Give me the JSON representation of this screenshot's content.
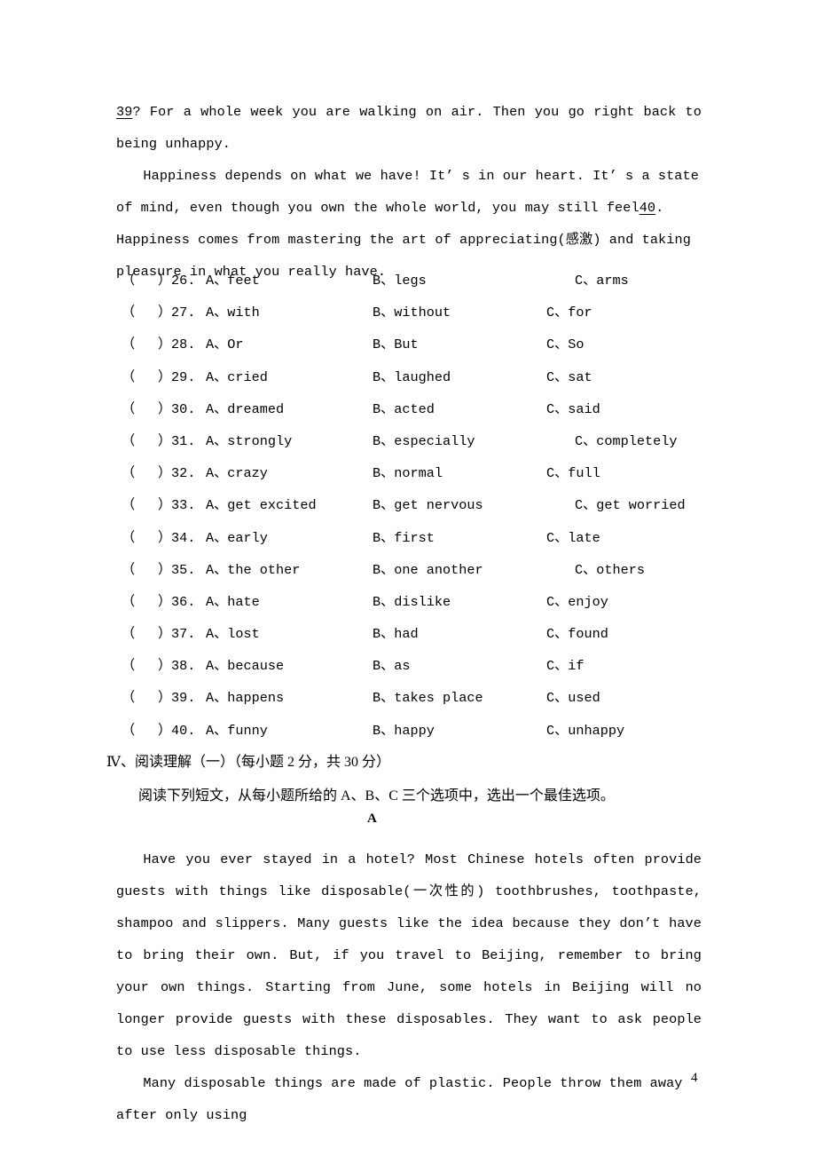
{
  "document": {
    "page_number": "4"
  },
  "cloze_passage": {
    "paragraphs": [
      {
        "blank_prefix": "39",
        "text": "? For a whole week you are walking on air. Then you go right back to being unhappy.",
        "indent": false
      },
      {
        "text_before_blank": "Happiness depends on what we have! It’ s in our heart. It’ s a state of mind, even though you own the whole world, you may still feel",
        "blank_inline": "40",
        "text_after_blank": ". Happiness comes from mastering the art of appreciating(感激) and taking pleasure in what you really have.",
        "indent": true
      }
    ]
  },
  "options": {
    "column_headers": [
      "A",
      "B",
      "C"
    ],
    "paren_open": "（",
    "paren_close": "）",
    "separator": "、",
    "rows": [
      {
        "number": "26.",
        "a": "A、feet",
        "b": "B、legs",
        "c": "C、arms",
        "c_shifted": true
      },
      {
        "number": "27.",
        "a": "A、with",
        "b": "B、without",
        "c": "C、for",
        "c_shifted": false
      },
      {
        "number": "28.",
        "a": "A、Or",
        "b": "B、But",
        "c": "C、So",
        "c_shifted": false
      },
      {
        "number": "29.",
        "a": "A、cried",
        "b": "B、laughed",
        "c": "C、sat",
        "c_shifted": false
      },
      {
        "number": "30.",
        "a": "A、dreamed",
        "b": "B、acted",
        "c": "C、said",
        "c_shifted": false
      },
      {
        "number": "31.",
        "a": "A、strongly",
        "b": "B、especially",
        "c": "C、completely",
        "c_shifted": true
      },
      {
        "number": "32.",
        "a": "A、crazy",
        "b": "B、normal",
        "c": "C、full",
        "c_shifted": false
      },
      {
        "number": "33.",
        "a": "A、get excited",
        "b": "B、get nervous",
        "c": "C、get worried",
        "c_shifted": true
      },
      {
        "number": "34.",
        "a": "A、early",
        "b": "B、first",
        "c": "C、late",
        "c_shifted": false
      },
      {
        "number": "35.",
        "a": "A、the other",
        "b": "B、one another",
        "c": "C、others",
        "c_shifted": true
      },
      {
        "number": "36.",
        "a": "A、hate",
        "b": "B、dislike",
        "c": "C、enjoy",
        "c_shifted": false
      },
      {
        "number": "37.",
        "a": "A、lost",
        "b": "B、had",
        "c": "C、found",
        "c_shifted": false
      },
      {
        "number": "38.",
        "a": "A、because",
        "b": "B、as",
        "c": "C、if",
        "c_shifted": false
      },
      {
        "number": "39.",
        "a": "A、happens",
        "b": "B、takes place",
        "c": "C、used",
        "c_shifted": false
      },
      {
        "number": "40.",
        "a": "A、funny",
        "b": "B、happy",
        "c": "C、unhappy",
        "c_shifted": false
      }
    ]
  },
  "reading_section": {
    "heading": "Ⅳ、阅读理解（一）（每小题 2 分，共 30 分）",
    "instruction": "阅读下列短文，从每小题所给的 A、B、C 三个选项中，选出一个最佳选项。",
    "passage_label": "A",
    "paragraphs": [
      "Have you ever stayed in a hotel? Most Chinese hotels often provide guests with things like disposable(一次性的) toothbrushes, toothpaste, shampoo and slippers. Many guests like the idea because they don’t have to bring their own. But, if you travel to Beijing, remember to bring your own things. Starting from June, some hotels in Beijing will no longer provide guests with these disposables. They want to ask people to use less disposable things.",
      "Many disposable things are made of plastic. People throw them away after only using"
    ]
  }
}
